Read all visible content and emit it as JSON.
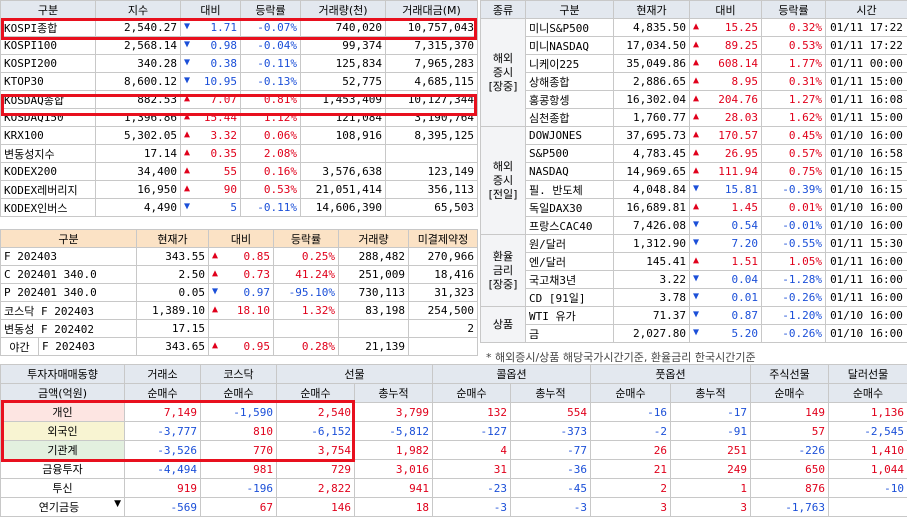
{
  "domestic_index": {
    "headers": [
      "구분",
      "지수",
      "대비",
      "등락률",
      "거래량(천)",
      "거래대금(M)"
    ],
    "rows": [
      [
        "KOSPI종합",
        "2,540.27",
        "dn",
        "1.71",
        "-0.07%",
        "740,020",
        "10,757,043"
      ],
      [
        "KOSPI100",
        "2,568.14",
        "dn",
        "0.98",
        "-0.04%",
        "99,374",
        "7,315,370"
      ],
      [
        "KOSPI200",
        "340.28",
        "dn",
        "0.38",
        "-0.11%",
        "125,834",
        "7,965,283"
      ],
      [
        "KTOP30",
        "8,600.12",
        "dn",
        "10.95",
        "-0.13%",
        "52,775",
        "4,685,115"
      ],
      [
        "KOSDAQ종합",
        "882.53",
        "up",
        "7.07",
        "0.81%",
        "1,453,409",
        "10,127,344"
      ],
      [
        "KOSDAQ150",
        "1,396.86",
        "up",
        "15.44",
        "1.12%",
        "121,084",
        "3,190,764"
      ],
      [
        "KRX100",
        "5,302.05",
        "up",
        "3.32",
        "0.06%",
        "108,916",
        "8,395,125"
      ],
      [
        "변동성지수",
        "17.14",
        "up",
        "0.35",
        "2.08%",
        "",
        ""
      ],
      [
        "KODEX200",
        "34,400",
        "up",
        "55",
        "0.16%",
        "3,576,638",
        "123,149"
      ],
      [
        "KODEX레버리지",
        "16,950",
        "up",
        "90",
        "0.53%",
        "21,051,414",
        "356,113"
      ],
      [
        "KODEX인버스",
        "4,490",
        "dn",
        "5",
        "-0.11%",
        "14,606,390",
        "65,503"
      ]
    ]
  },
  "futures": {
    "headers": [
      "구분",
      "현재가",
      "대비",
      "등락률",
      "거래량",
      "미결제약정"
    ],
    "rows": [
      [
        "F 202403",
        "343.55",
        "up",
        "0.85",
        "0.25%",
        "288,482",
        "270,966"
      ],
      [
        "C 202401 340.0",
        "2.50",
        "up",
        "0.73",
        "41.24%",
        "251,009",
        "18,416"
      ],
      [
        "P 202401 340.0",
        "0.05",
        "dn",
        "0.97",
        "-95.10%",
        "730,113",
        "31,323"
      ],
      [
        "코스닥 F 202403",
        "1,389.10",
        "up",
        "18.10",
        "1.32%",
        "83,198",
        "254,500"
      ],
      [
        "변동성 F 202402",
        "17.15",
        "",
        "",
        "",
        "",
        "2"
      ]
    ],
    "night_label": "야간",
    "night": [
      "F 202403",
      "343.65",
      "up",
      "0.95",
      "0.28%",
      "21,139",
      ""
    ]
  },
  "global": {
    "headers": [
      "종류",
      "구분",
      "현재가",
      "대비",
      "등락률",
      "시간"
    ],
    "groups": [
      {
        "label": "해외\n증시\n[장중]",
        "rows": [
          [
            "미니S&P500",
            "4,835.50",
            "up",
            "15.25",
            "0.32%",
            "01/11 17:22"
          ],
          [
            "미니NASDAQ",
            "17,034.50",
            "up",
            "89.25",
            "0.53%",
            "01/11 17:22"
          ],
          [
            "니케이225",
            "35,049.86",
            "up",
            "608.14",
            "1.77%",
            "01/11 00:00"
          ],
          [
            "상해종합",
            "2,886.65",
            "up",
            "8.95",
            "0.31%",
            "01/11 15:00"
          ],
          [
            "홍콩항셍",
            "16,302.04",
            "up",
            "204.76",
            "1.27%",
            "01/11 16:08"
          ],
          [
            "심천종합",
            "1,760.77",
            "up",
            "28.03",
            "1.62%",
            "01/11 15:00"
          ]
        ]
      },
      {
        "label": "해외\n증시\n[전일]",
        "rows": [
          [
            "DOWJONES",
            "37,695.73",
            "up",
            "170.57",
            "0.45%",
            "01/10 16:00"
          ],
          [
            "S&P500",
            "4,783.45",
            "up",
            "26.95",
            "0.57%",
            "01/10 16:58"
          ],
          [
            "NASDAQ",
            "14,969.65",
            "up",
            "111.94",
            "0.75%",
            "01/10 16:15"
          ],
          [
            "필. 반도체",
            "4,048.84",
            "dn",
            "15.81",
            "-0.39%",
            "01/10 16:15"
          ],
          [
            "독일DAX30",
            "16,689.81",
            "up",
            "1.45",
            "0.01%",
            "01/10 16:00"
          ],
          [
            "프랑스CAC40",
            "7,426.08",
            "dn",
            "0.54",
            "-0.01%",
            "01/10 16:00"
          ]
        ]
      },
      {
        "label": "환율\n금리\n[장중]",
        "rows": [
          [
            "원/달러",
            "1,312.90",
            "dn",
            "7.20",
            "-0.55%",
            "01/11 15:30"
          ],
          [
            "엔/달러",
            "145.41",
            "up",
            "1.51",
            "1.05%",
            "01/11 16:00"
          ],
          [
            "국고채3년",
            "3.22",
            "dn",
            "0.04",
            "-1.28%",
            "01/11 16:00"
          ],
          [
            "CD [91일]",
            "3.78",
            "dn",
            "0.01",
            "-0.26%",
            "01/11 16:00"
          ]
        ]
      },
      {
        "label": "상품",
        "rows": [
          [
            "WTI 유가",
            "71.37",
            "dn",
            "0.87",
            "-1.20%",
            "01/10 16:00"
          ],
          [
            "금",
            "2,027.80",
            "dn",
            "5.20",
            "-0.26%",
            "01/10 16:00"
          ]
        ]
      }
    ]
  },
  "note": "* 해외증시/상품 해당국가시간기준, 환율금리 한국시간기준",
  "investor": {
    "title": "투자자매매동향",
    "unit_label": "금액(억원)",
    "groups": [
      "거래소",
      "코스닥",
      "선물",
      "콜옵션",
      "풋옵션",
      "주식선물",
      "달러선물"
    ],
    "subheaders": [
      "순매수",
      "순매수",
      "순매수",
      "총누적",
      "순매수",
      "총누적",
      "순매수",
      "총누적",
      "순매수",
      "순매수"
    ],
    "rows": [
      [
        "개인",
        "7,149",
        "-1,590",
        "2,540",
        "3,799",
        "132",
        "554",
        "-16",
        "-17",
        "149",
        "1,136"
      ],
      [
        "외국인",
        "-3,777",
        "810",
        "-6,152",
        "-5,812",
        "-127",
        "-373",
        "-2",
        "-91",
        "57",
        "-2,545"
      ],
      [
        "기관계",
        "-3,526",
        "770",
        "3,754",
        "1,982",
        "4",
        "-77",
        "26",
        "251",
        "-226",
        "1,410"
      ],
      [
        "금융투자",
        "-4,494",
        "981",
        "729",
        "3,016",
        "31",
        "-36",
        "21",
        "249",
        "650",
        "1,044"
      ],
      [
        "투신",
        "919",
        "-196",
        "2,822",
        "941",
        "-23",
        "-45",
        "2",
        "1",
        "876",
        "-10"
      ],
      [
        "연기금등",
        "-569",
        "67",
        "146",
        "18",
        "-3",
        "-3",
        "3",
        "3",
        "-1,763",
        ""
      ]
    ]
  }
}
